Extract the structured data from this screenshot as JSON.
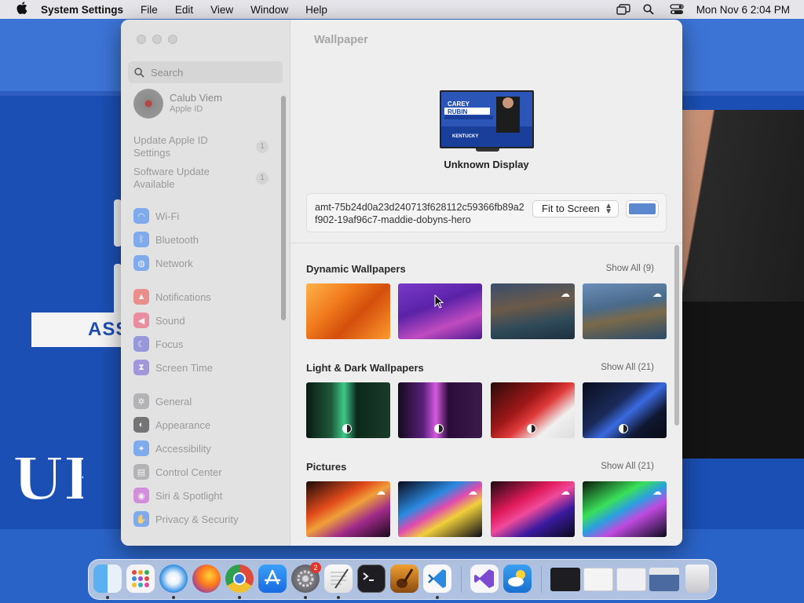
{
  "menubar": {
    "app_name": "System Settings",
    "menus": [
      "File",
      "Edit",
      "View",
      "Window",
      "Help"
    ],
    "clock": "Mon Nov 6  2:04 PM"
  },
  "desktop": {
    "banner_text": "ASS"
  },
  "sidebar": {
    "search_placeholder": "Search",
    "account": {
      "name": "Calub Viem",
      "subtitle": "Apple ID"
    },
    "alerts": [
      {
        "label": "Update Apple ID Settings",
        "count": "1"
      },
      {
        "label": "Software Update Available",
        "count": "1"
      }
    ],
    "items": [
      {
        "label": "Wi-Fi",
        "icon": "wifi-icon",
        "color": "#2f7ff6"
      },
      {
        "label": "Bluetooth",
        "icon": "bluetooth-icon",
        "color": "#2f7ff6"
      },
      {
        "label": "Network",
        "icon": "globe-icon",
        "color": "#2f7ff6"
      },
      {
        "label": "Notifications",
        "icon": "bell-icon",
        "color": "#ef4a44"
      },
      {
        "label": "Sound",
        "icon": "speaker-icon",
        "color": "#ef4a6a"
      },
      {
        "label": "Focus",
        "icon": "moon-icon",
        "color": "#5b5bd6"
      },
      {
        "label": "Screen Time",
        "icon": "hourglass-icon",
        "color": "#6b5bd6"
      },
      {
        "label": "General",
        "icon": "gear-icon",
        "color": "#8e8e93"
      },
      {
        "label": "Appearance",
        "icon": "appearance-icon",
        "color": "#1c1c1e"
      },
      {
        "label": "Accessibility",
        "icon": "accessibility-icon",
        "color": "#2f7ff6"
      },
      {
        "label": "Control Center",
        "icon": "control-center-icon",
        "color": "#8e8e93"
      },
      {
        "label": "Siri & Spotlight",
        "icon": "siri-icon",
        "color": "#c54bd6"
      },
      {
        "label": "Privacy & Security",
        "icon": "hand-icon",
        "color": "#2f7ff6"
      }
    ]
  },
  "main": {
    "title": "Wallpaper",
    "display_name": "Unknown Display",
    "display_preview": {
      "name_line1": "CAREY",
      "name_line2": "RUBIN",
      "school": "KENTUCKY"
    },
    "wallpaper_file": "amt-75b24d0a23d240713f628112c59366fb89a2f902-19af96c7-maddie-dobyns-hero",
    "fit_option": "Fit to Screen",
    "fill_color": "#5b88cf",
    "sections": [
      {
        "title": "Dynamic Wallpapers",
        "show_all": "Show All (9)"
      },
      {
        "title": "Light & Dark Wallpapers",
        "show_all": "Show All (21)"
      },
      {
        "title": "Pictures",
        "show_all": "Show All (21)"
      }
    ]
  },
  "dock": {
    "settings_badge": "2",
    "apps": [
      "finder",
      "launchpad",
      "safari",
      "firefox",
      "chrome",
      "app-store",
      "system-settings",
      "textedit",
      "terminal",
      "garageband",
      "vscode",
      "visual-studio",
      "weather",
      "recent-window-1",
      "recent-window-2",
      "recent-window-3",
      "recent-window-4",
      "trash"
    ]
  }
}
